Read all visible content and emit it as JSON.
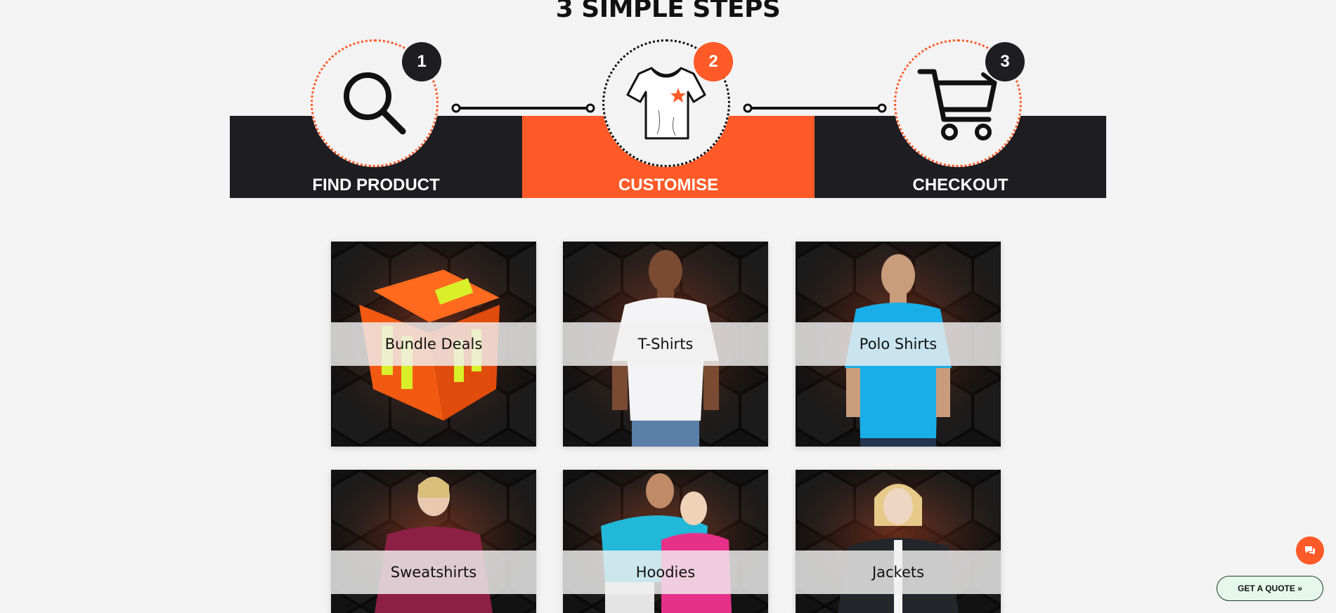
{
  "section_title": "3 SIMPLE STEPS",
  "steps": [
    {
      "number": "1",
      "label": "FIND PRODUCT",
      "icon": "search-icon"
    },
    {
      "number": "2",
      "label": "CUSTOMISE",
      "icon": "tshirt-icon"
    },
    {
      "number": "3",
      "label": "CHECKOUT",
      "icon": "shopping-cart-icon"
    }
  ],
  "categories": [
    {
      "label": "Bundle Deals"
    },
    {
      "label": "T-Shirts"
    },
    {
      "label": "Polo Shirts"
    },
    {
      "label": "Sweatshirts"
    },
    {
      "label": "Hoodies"
    },
    {
      "label": "Jackets"
    }
  ],
  "chat": {
    "icon": "chat-icon"
  },
  "quote_button": {
    "label": "GET A QUOTE »"
  },
  "colors": {
    "accent": "#ff5a27",
    "dark": "#1e1d22",
    "background": "#f3f3f3"
  }
}
